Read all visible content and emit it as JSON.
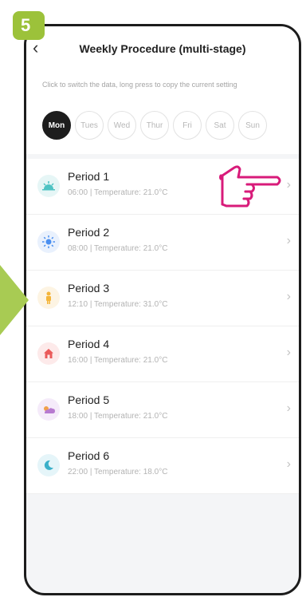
{
  "step": "5",
  "header": {
    "title": "Weekly Procedure (multi-stage)",
    "back_icon": "chevron-left-icon",
    "hint": "Click to switch the data, long press to copy the current setting"
  },
  "days": [
    "Mon",
    "Tues",
    "Wed",
    "Thur",
    "Fri",
    "Sat",
    "Sun"
  ],
  "selected_day": "Mon",
  "periods": [
    {
      "label": "Period 1",
      "time": "06:00",
      "temperature": "Temperature: 21.0°C",
      "icon": "sunrise-icon",
      "color": "#4fc3c3"
    },
    {
      "label": "Period 2",
      "time": "08:00",
      "temperature": "Temperature: 21.0°C",
      "icon": "sun-icon",
      "color": "#4a8ff0"
    },
    {
      "label": "Period 3",
      "time": "12:10",
      "temperature": "Temperature: 31.0°C",
      "icon": "person-icon",
      "color": "#f4b53a"
    },
    {
      "label": "Period 4",
      "time": "16:00",
      "temperature": "Temperature: 21.0°C",
      "icon": "home-icon",
      "color": "#ea5b5b"
    },
    {
      "label": "Period 5",
      "time": "18:00",
      "temperature": "Temperature: 21.0°C",
      "icon": "sunset-icon",
      "color": "#b77ad0"
    },
    {
      "label": "Period 6",
      "time": "22:00",
      "temperature": "Temperature: 18.0°C",
      "icon": "moon-icon",
      "color": "#3ab0c9"
    }
  ],
  "separator": "|",
  "colors": {
    "badge": "#9cc23a",
    "pointer": "#d81b7a",
    "active_day": "#1d1d1d"
  }
}
